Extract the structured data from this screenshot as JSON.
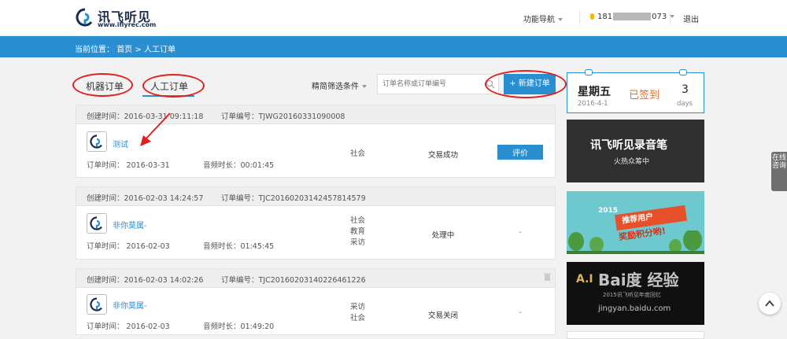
{
  "header": {
    "logo_text": "讯飞听见",
    "logo_url": "www.iflyrec.com",
    "nav_menu": "功能导航",
    "user_prefix": "181",
    "user_suffix": "073",
    "logout": "退出"
  },
  "breadcrumb": {
    "label": "当前位置：",
    "home": "首页",
    "separator": ">",
    "current": "人工订单"
  },
  "tabs": [
    {
      "label": "机器订单"
    },
    {
      "label": "人工订单"
    }
  ],
  "toolbar": {
    "filter": "精简筛选条件",
    "search_placeholder": "订单名称或订单编号",
    "new_order": "+ 新建订单"
  },
  "orders": [
    {
      "created": "创建时间：2016-03-31 09:11:18",
      "number": "订单编号：TJWG20160331090008",
      "name": "测试",
      "order_date": "订单时间： 2016-03-31",
      "duration": "音频时长：00:01:45",
      "tags": [
        "社会"
      ],
      "status": "交易成功",
      "action": "评价"
    },
    {
      "created": "创建时间：2016-02-03 14:24:57",
      "number": "订单编号：TJC20160203142457814579",
      "name": "非你莫属-",
      "order_date": "订单时间： 2016-02-03",
      "duration": "音频时长：01:45:45",
      "tags": [
        "社会",
        "教育",
        "采访"
      ],
      "status": "处理中",
      "action": "-"
    },
    {
      "created": "创建时间：2016-02-03 14:02:26",
      "number": "订单编号：TJC20160203140226461226",
      "name": "非你莫属-",
      "order_date": "订单时间： 2016-02-03",
      "duration": "音频时长：01:49:20",
      "tags": [
        "采访",
        "社会"
      ],
      "status": "交易关闭",
      "action": "-"
    }
  ],
  "checkin": {
    "weekday": "星期五",
    "date": "2016-4-1",
    "status": "已签到",
    "days": "3",
    "days_label": "days"
  },
  "banners": {
    "b1_title": "讯飞听见录音笔",
    "b1_sub": "火热众筹中",
    "b2_year": "2015",
    "b2_line1": "推荐用户",
    "b2_line2": "奖励积分哟!",
    "b3_title": "A.I",
    "b3_sub": "2015讯飞听见年度回忆"
  },
  "side": {
    "consult": "在线咨询"
  },
  "watermark": {
    "main": "Bai度 经验",
    "url": "jingyan.baidu.com"
  },
  "colors": {
    "accent": "#2a8fd0",
    "highlight": "#e02020",
    "checked": "#f26b1d"
  }
}
